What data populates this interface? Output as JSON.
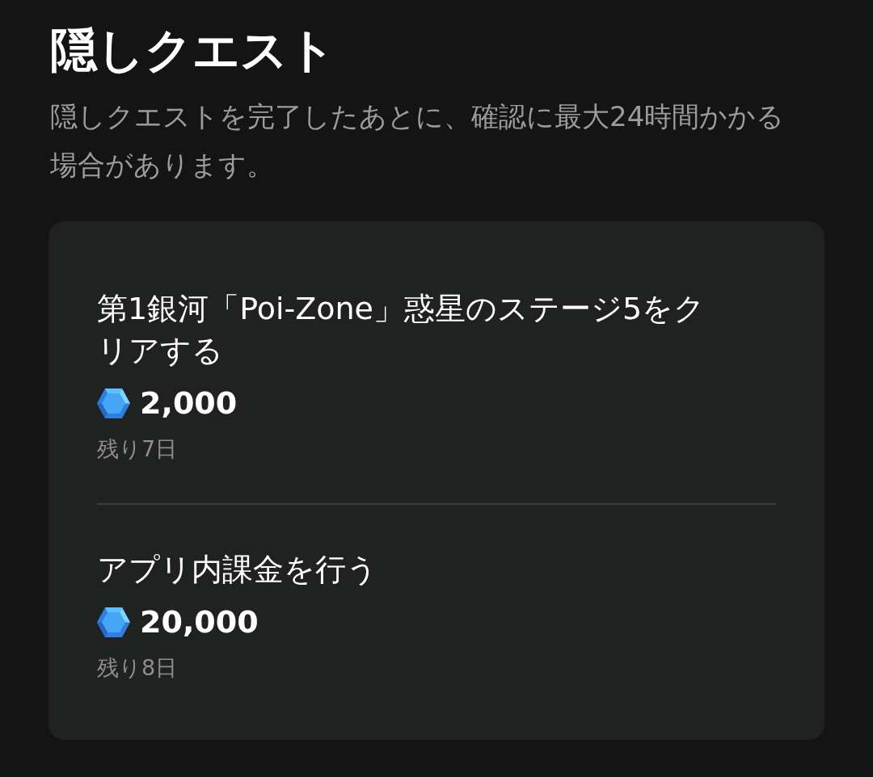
{
  "header": {
    "title": "隠しクエスト",
    "description": "隠しクエストを完了したあとに、確認に最大24時間かかる場合があります。"
  },
  "quests": [
    {
      "title": "第1銀河「Poi-Zone」惑星のステージ5をクリアする",
      "reward": "2,000",
      "remaining": "残り7日"
    },
    {
      "title": "アプリ内課金を行う",
      "reward": "20,000",
      "remaining": "残り8日"
    }
  ]
}
